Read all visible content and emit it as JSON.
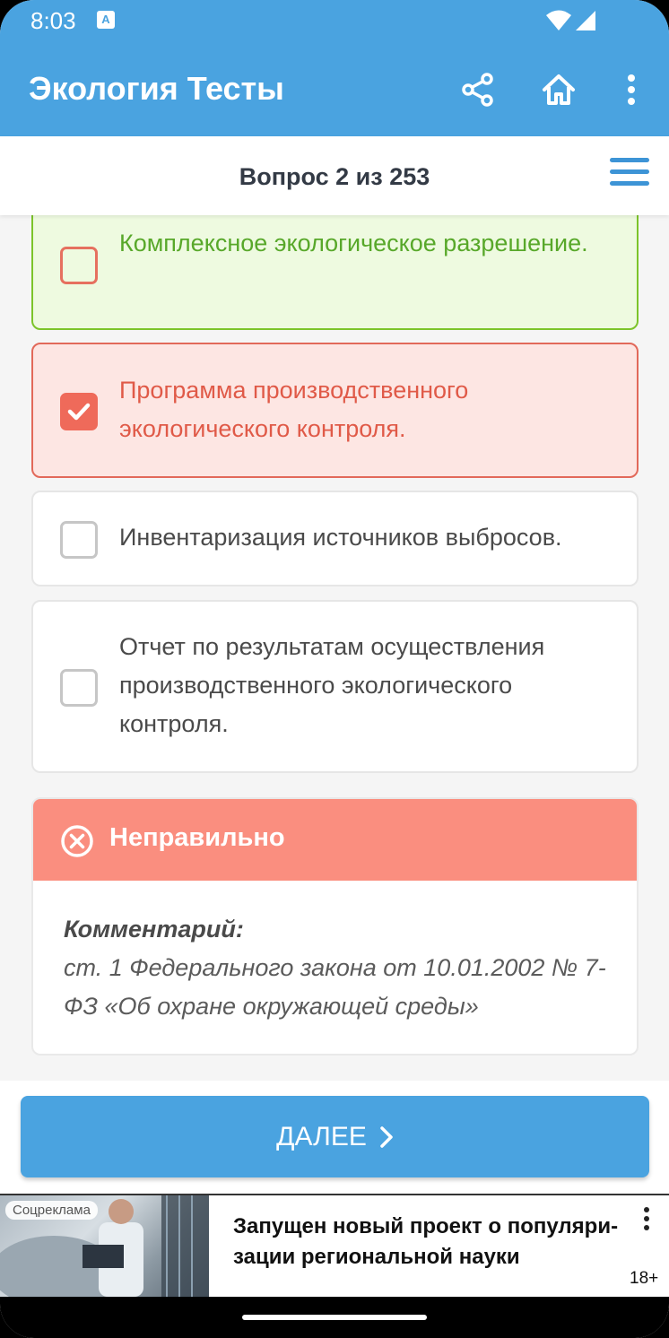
{
  "status_bar": {
    "time": "8:03",
    "notification_icon": "A"
  },
  "app_bar": {
    "title": "Экология Тесты",
    "icons": [
      "share-icon",
      "home-icon",
      "more-vert-icon"
    ]
  },
  "question": {
    "counter": "Вопрос 2 из 253"
  },
  "answers": [
    {
      "text": "Комплексное экологическое разрешение.",
      "state": "correct",
      "checked": false
    },
    {
      "text": "Программа производственного экологического контроля.",
      "state": "wrong",
      "checked": true
    },
    {
      "text": "Инвентаризация источников выбросов.",
      "state": "neutral",
      "checked": false
    },
    {
      "text": "Отчет по результатам осуществления производственного экологического контроля.",
      "state": "neutral",
      "checked": false
    }
  ],
  "result": {
    "title": "Неправильно",
    "comment_label": "Комментарий:",
    "comment_text": "ст. 1 Федерального закона от 10.01.2002 № 7-ФЗ «Об охране окружающей среды»"
  },
  "next_button": {
    "label": "ДАЛЕЕ"
  },
  "ad": {
    "label": "Соцреклама",
    "text": "Запущен новый проект о популяри-зации региональной науки",
    "age": "18+"
  },
  "colors": {
    "primary": "#4aa3e0",
    "correct": "#7cc42a",
    "wrong": "#e2695a",
    "result_header": "#fa8e7f"
  }
}
